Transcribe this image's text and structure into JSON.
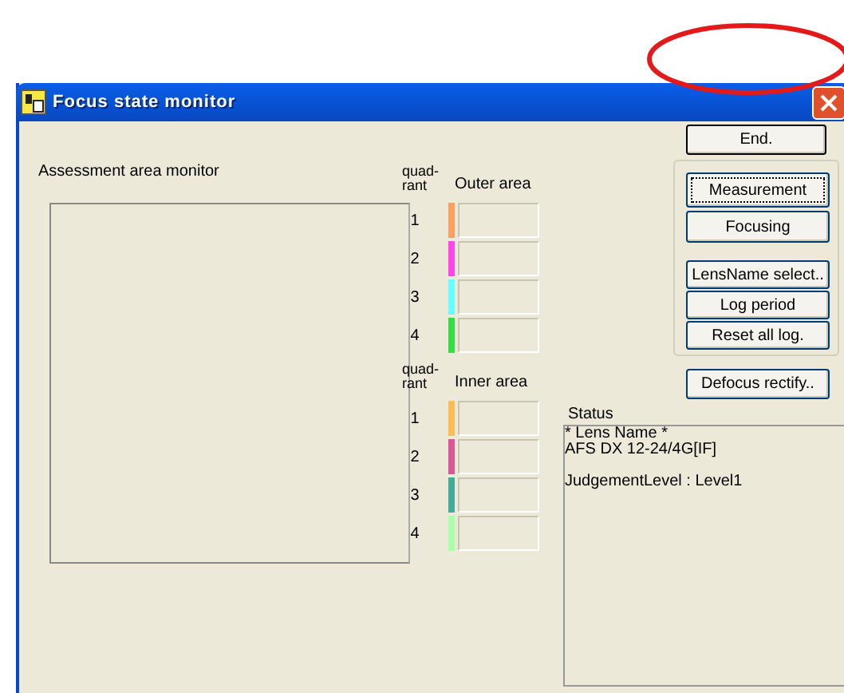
{
  "window": {
    "title": "Focus state monitor"
  },
  "assessment_area": {
    "label": "Assessment area monitor"
  },
  "quadrant_groups": [
    {
      "header": "quad-\nrant",
      "area_label": "Outer area",
      "quadrants": [
        {
          "number": "1",
          "color": "#ff9f5f"
        },
        {
          "number": "2",
          "color": "#ff44ee"
        },
        {
          "number": "3",
          "color": "#66ffff"
        },
        {
          "number": "4",
          "color": "#33dd44"
        }
      ]
    },
    {
      "header": "quad-\nrant",
      "area_label": "Inner area",
      "quadrants": [
        {
          "number": "1",
          "color": "#ffbb55"
        },
        {
          "number": "2",
          "color": "#dd5599"
        },
        {
          "number": "3",
          "color": "#44aa99"
        },
        {
          "number": "4",
          "color": "#aaffaa"
        }
      ]
    }
  ],
  "end_button": {
    "label": "End.",
    "focused": false
  },
  "button_group": [
    {
      "label": "Measurement",
      "focused": true
    },
    {
      "label": "Focusing",
      "focused": false
    },
    {
      "label": "LensName select..",
      "focused": false
    },
    {
      "label": "Log period",
      "focused": false
    },
    {
      "label": "Reset all log.",
      "focused": false
    }
  ],
  "defocus_button": {
    "label": "Defocus rectify..",
    "focused": false
  },
  "status": {
    "label": "Status",
    "lines": [
      "* Lens Name *",
      "AFS DX 12-24/4G[IF]"
    ],
    "judgement": "JudgementLevel : Level1"
  }
}
